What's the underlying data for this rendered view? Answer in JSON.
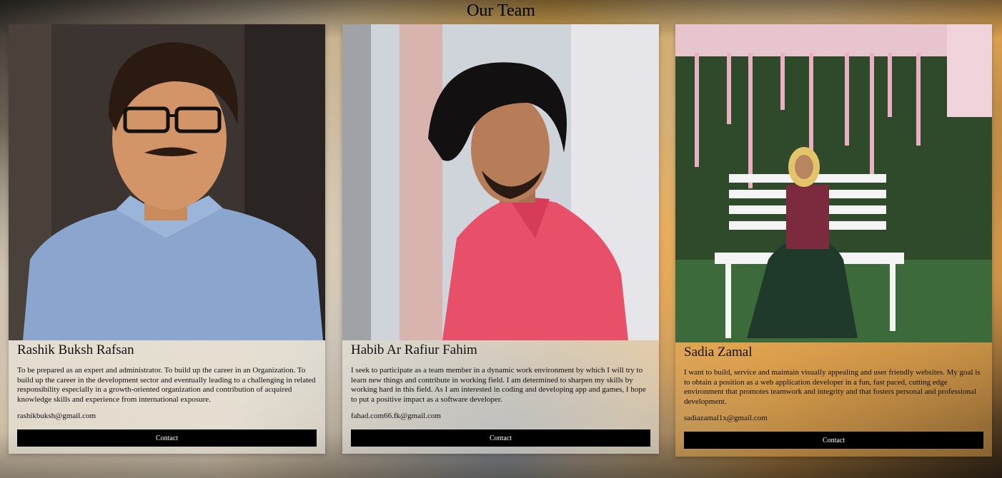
{
  "page": {
    "title": "Our Team"
  },
  "members": [
    {
      "name": "Rashik Buksh Rafsan",
      "bio": "To be prepared as an expert and administrator. To build up the career in an Organization. To build up the career in the development sector and eventually leading to a challenging in related responsibility especially in a growth-oriented organization and contribution of acquired knowledge skills and experience from international exposure.",
      "email": "rashikbuksh@gmail.com",
      "contact_label": "Contact"
    },
    {
      "name": "Habib Ar Rafiur Fahim",
      "bio": "I seek to participate as a team member in a dynamic work environment by which I will try to learn new things and contribute in working field. I am determined to sharpen my skills by working hard in this field. As I am interested in coding and developing app and games, I hope to put a positive impact as a software developer.",
      "email": "fahad.com66.fk@gmail.com",
      "contact_label": "Contact"
    },
    {
      "name": "Sadia Zamal",
      "bio": "I want to build, service and maintain visually appealing and user friendly websites. My goal is to obtain a position as a web application developer in a fun, fast paced, cutting edge environment that promotes teamwork and integrity and that fosters personal and professional development.",
      "email": "sadiazamal1x@gmail.com",
      "contact_label": "Contact"
    }
  ]
}
